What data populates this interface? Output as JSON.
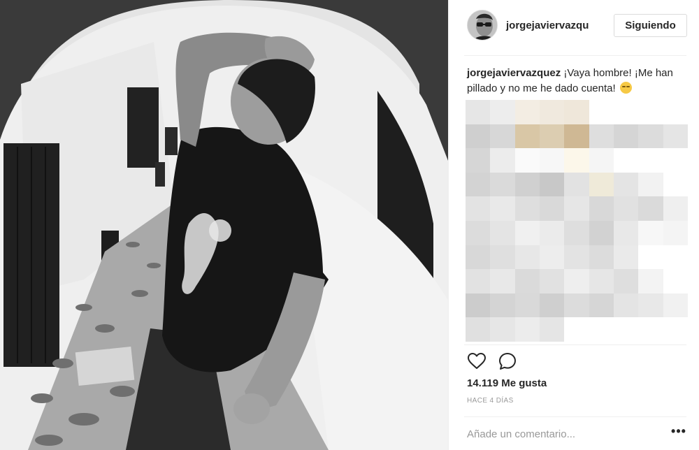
{
  "post": {
    "photo_alt": "",
    "author": {
      "username": "jorgejaviervazqu",
      "follow_label": "Siguiendo"
    },
    "caption": {
      "username": "jorgejavierva zquez",
      "username_full": "jorgejaviervazquez",
      "text": " ¡Vaya hombre! ¡Me han pillado y no me he dado cuenta! ",
      "emoji": "relieved-face-emoji"
    },
    "comments_blurred": true,
    "actions": {
      "like_icon": "heart-icon",
      "comment_icon": "speech-bubble-icon"
    },
    "likes_text": "14.119 Me gusta",
    "timestamp": "HACE 4 DÍAS",
    "comment_placeholder": "Añade un comentario...",
    "more_label": "•••",
    "colors": {
      "text": "#262626",
      "muted": "#999999",
      "border": "#dbdbdb"
    }
  }
}
